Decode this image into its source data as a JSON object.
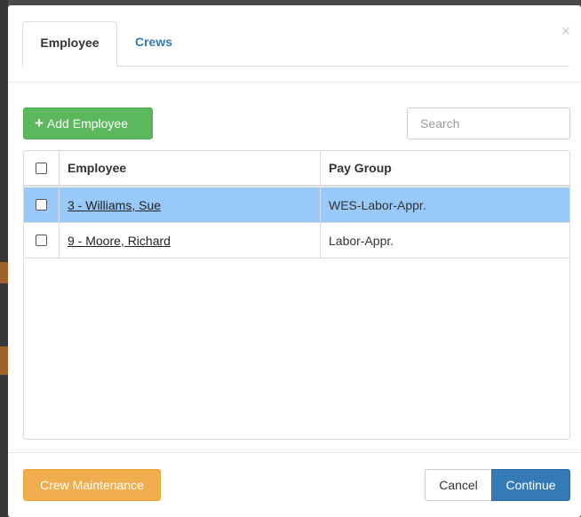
{
  "modal": {
    "close_symbol": "×",
    "tabs": [
      {
        "label": "Employee",
        "active": true
      },
      {
        "label": "Crews",
        "active": false
      }
    ],
    "add_button": {
      "icon": "plus-icon",
      "icon_glyph": "+",
      "label": "Add Employee"
    },
    "search": {
      "placeholder": "Search",
      "value": ""
    },
    "table": {
      "columns": [
        "Employee",
        "Pay Group"
      ],
      "rows": [
        {
          "employee": "3 - Williams, Sue",
          "pay_group": "WES-Labor-Appr.",
          "selected": true
        },
        {
          "employee": "9 - Moore, Richard",
          "pay_group": "Labor-Appr.",
          "selected": false
        }
      ]
    },
    "footer": {
      "crew_maintenance_label": "Crew Maintenance",
      "cancel_label": "Cancel",
      "continue_label": "Continue"
    }
  },
  "colors": {
    "success": "#5cb85c",
    "warning": "#f0ad4e",
    "primary": "#337ab7",
    "row_highlight": "#99c9f9"
  }
}
